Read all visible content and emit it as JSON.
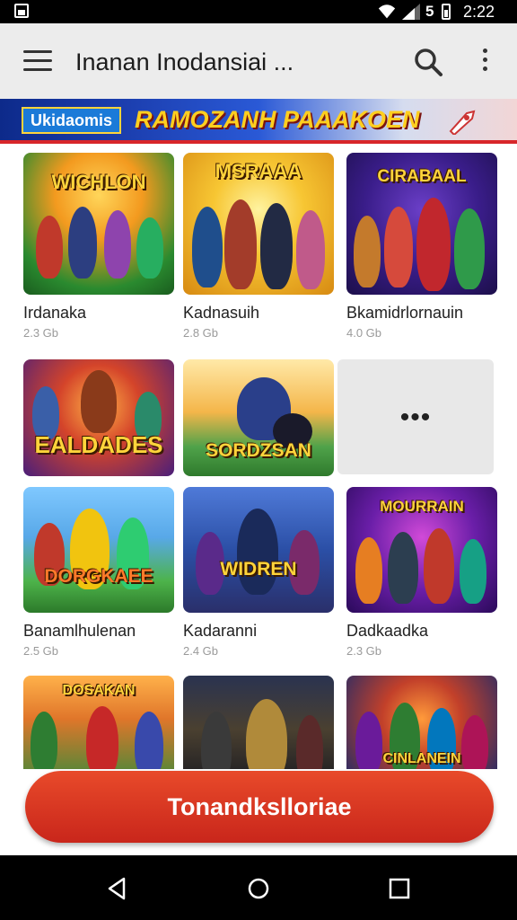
{
  "status_bar": {
    "time": "2:22",
    "network": "5"
  },
  "app_bar": {
    "title": "Inanan Inodansiai ..."
  },
  "banner": {
    "badge": "Ukidaomis",
    "headline": "RAMOZANH PAAAKOEN"
  },
  "games": [
    {
      "thumb_title": "WICHLON",
      "name": "Irdanaka",
      "meta": "2.3 Gb"
    },
    {
      "thumb_title": "MSRAAA",
      "name": "Kadnasuih",
      "meta": "2.8 Gb"
    },
    {
      "thumb_title": "CIRABAAL",
      "name": "Bkamidrlornauin",
      "meta": "4.0 Gb"
    },
    {
      "thumb_title": "EALDADES",
      "name": "",
      "meta": ""
    },
    {
      "thumb_title": "SORDZSAN",
      "name": "",
      "meta": ""
    },
    {
      "thumb_title": "DORGKAEE",
      "name": "Banamlhulenan",
      "meta": "2.5 Gb"
    },
    {
      "thumb_title": "WIDREN",
      "name": "Kadaranni",
      "meta": "2.4 Gb"
    },
    {
      "thumb_title": "MOURRAIN",
      "name": "Dadkaadka",
      "meta": "2.3 Gb"
    },
    {
      "thumb_title": "DOSAKAN",
      "name": "",
      "meta": ""
    },
    {
      "thumb_title": "",
      "name": "",
      "meta": ""
    },
    {
      "thumb_title": "CINLANEIN",
      "name": "",
      "meta": ""
    }
  ],
  "more_tile": {
    "label": "•••"
  },
  "cta": {
    "label": "Tonandkslloriae"
  },
  "colors": {
    "accent": "#d8262a",
    "cta": "#d33a21",
    "banner_text": "#ffcf1f"
  },
  "icons": [
    "menu-icon",
    "search-icon",
    "more-vert-icon",
    "wifi-icon",
    "signal-icon",
    "battery-icon",
    "back-icon",
    "home-icon",
    "recents-icon"
  ]
}
